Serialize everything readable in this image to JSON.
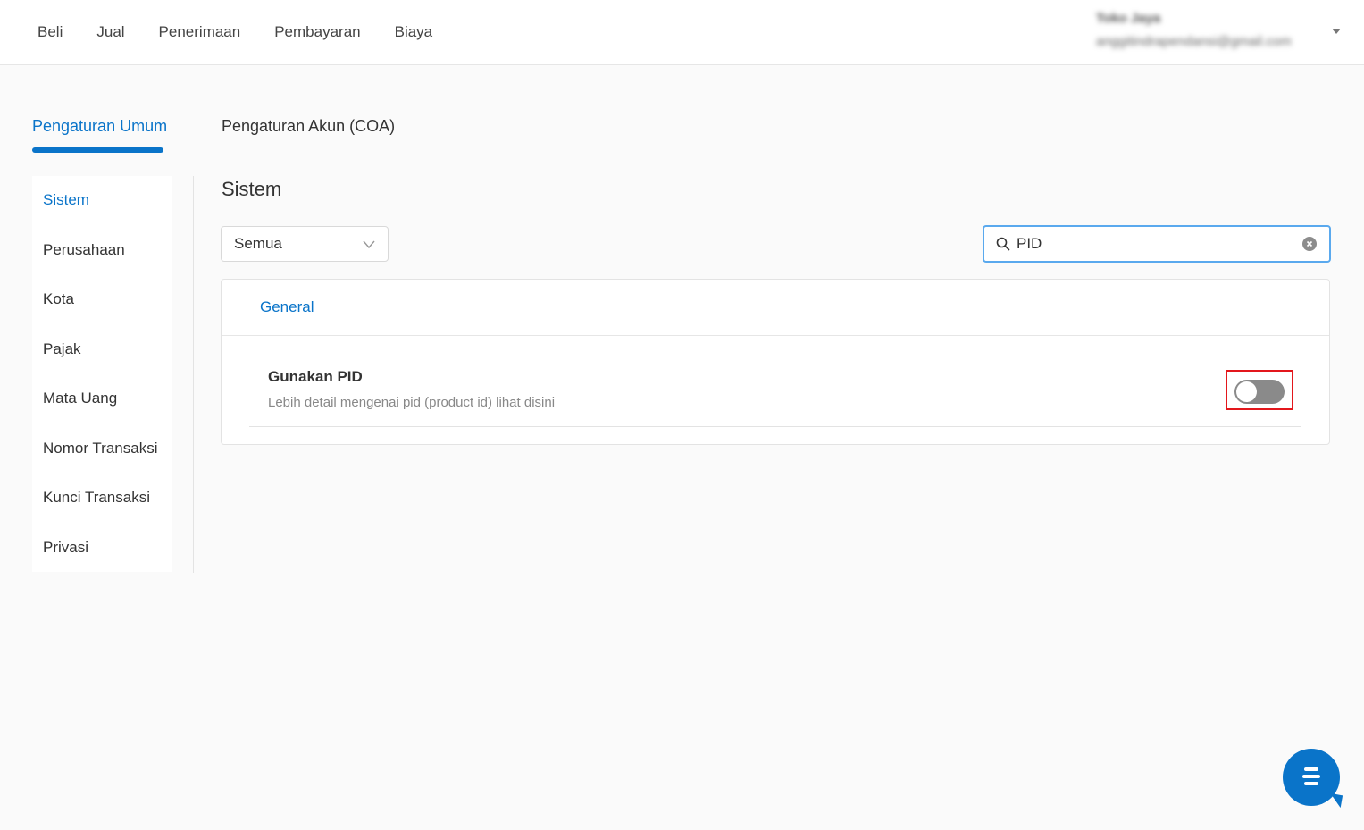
{
  "nav": {
    "items": [
      "Beli",
      "Jual",
      "Penerimaan",
      "Pembayaran",
      "Biaya"
    ]
  },
  "user": {
    "name": "Toko Jaya",
    "email": "anggitindrapendansi@gmail.com"
  },
  "tabs": {
    "active": "Pengaturan Umum",
    "inactive": "Pengaturan Akun (COA)"
  },
  "sidebar": {
    "items": [
      "Sistem",
      "Perusahaan",
      "Kota",
      "Pajak",
      "Mata Uang",
      "Nomor Transaksi",
      "Kunci Transaksi",
      "Privasi"
    ],
    "active_index": 0
  },
  "content": {
    "section_title": "Sistem",
    "filter_value": "Semua",
    "search_value": "PID",
    "card_title": "General",
    "setting": {
      "label": "Gunakan PID",
      "description": "Lebih detail mengenai pid (product id) lihat disini",
      "enabled": false
    }
  },
  "colors": {
    "accent": "#0a74c9",
    "highlight_border": "#e3171c",
    "toggle_off": "#8a8a8a"
  },
  "icons": {
    "search": "search-icon",
    "clear": "clear-icon",
    "chevron": "chevron-down-icon",
    "chat": "chat-icon",
    "caret": "caret-down-icon"
  }
}
